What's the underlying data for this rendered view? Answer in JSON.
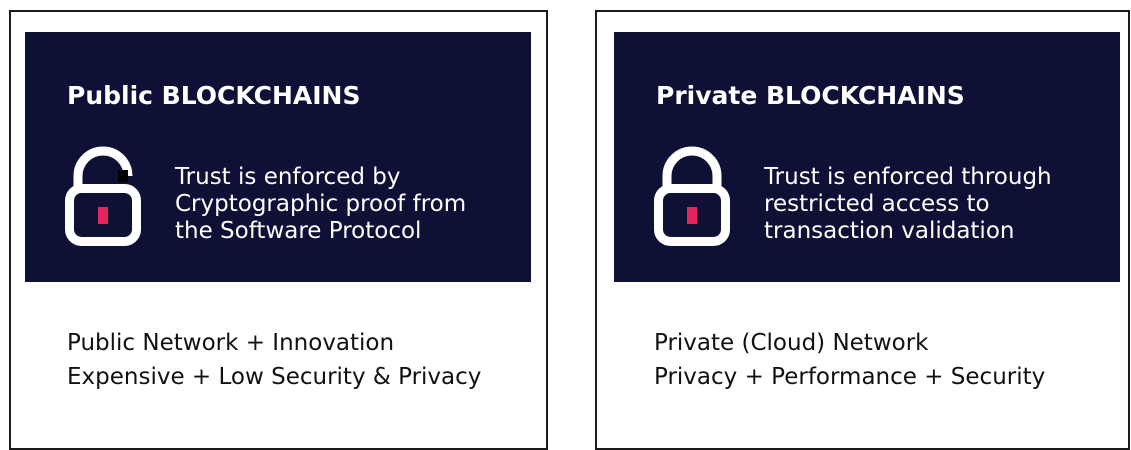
{
  "colors": {
    "panel_background": "#0f1035",
    "panel_text": "#ffffff",
    "keyhole_accent": "#e8245e",
    "border": "#1a1a1a"
  },
  "cards": [
    {
      "title": "Public BLOCKCHAINS",
      "icon": "unlocked-padlock-icon",
      "description_lines": [
        "Trust is enforced by",
        "Cryptographic proof from",
        "the Software Protocol"
      ],
      "summary_lines": [
        "Public Network + Innovation",
        "Expensive + Low Security & Privacy"
      ]
    },
    {
      "title": "Private BLOCKCHAINS",
      "icon": "locked-padlock-icon",
      "description_lines": [
        "Trust is enforced through",
        "restricted access to",
        "transaction validation"
      ],
      "summary_lines": [
        "Private (Cloud) Network",
        "Privacy + Performance + Security"
      ]
    }
  ]
}
